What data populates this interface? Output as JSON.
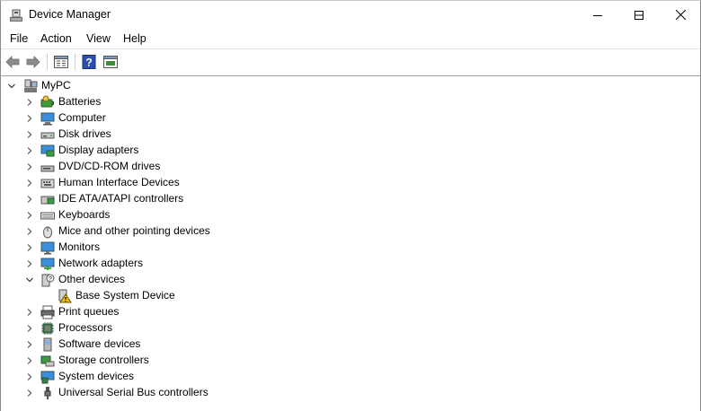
{
  "window": {
    "title": "Device Manager",
    "minimize_icon": "minimize-icon",
    "maximize_icon": "maximize-icon",
    "close_icon": "close-icon"
  },
  "menu": [
    "File",
    "Action",
    "View",
    "Help"
  ],
  "toolbar": {
    "buttons": [
      "back-arrow-icon",
      "forward-arrow-icon",
      "properties-icon",
      "help-icon",
      "update-driver-icon"
    ]
  },
  "tree": {
    "root": "MyPC",
    "categories": [
      {
        "label": "Batteries",
        "icon": "battery-icon"
      },
      {
        "label": "Computer",
        "icon": "computer-icon"
      },
      {
        "label": "Disk drives",
        "icon": "disk-drive-icon"
      },
      {
        "label": "Display adapters",
        "icon": "display-adapter-icon"
      },
      {
        "label": "DVD/CD-ROM drives",
        "icon": "dvd-drive-icon"
      },
      {
        "label": "Human Interface Devices",
        "icon": "hid-icon"
      },
      {
        "label": "IDE ATA/ATAPI controllers",
        "icon": "ide-controller-icon"
      },
      {
        "label": "Keyboards",
        "icon": "keyboard-icon"
      },
      {
        "label": "Mice and other pointing devices",
        "icon": "mouse-icon"
      },
      {
        "label": "Monitors",
        "icon": "monitor-icon"
      },
      {
        "label": "Network adapters",
        "icon": "network-adapter-icon"
      },
      {
        "label": "Other devices",
        "icon": "other-devices-icon",
        "expanded": true,
        "children": [
          {
            "label": "Base System Device",
            "icon": "warning-device-icon"
          }
        ]
      },
      {
        "label": "Print queues",
        "icon": "printer-icon"
      },
      {
        "label": "Processors",
        "icon": "processor-icon"
      },
      {
        "label": "Software devices",
        "icon": "software-device-icon"
      },
      {
        "label": "Storage controllers",
        "icon": "storage-controller-icon"
      },
      {
        "label": "System devices",
        "icon": "system-devices-icon"
      },
      {
        "label": "Universal Serial Bus controllers",
        "icon": "usb-icon"
      }
    ]
  }
}
